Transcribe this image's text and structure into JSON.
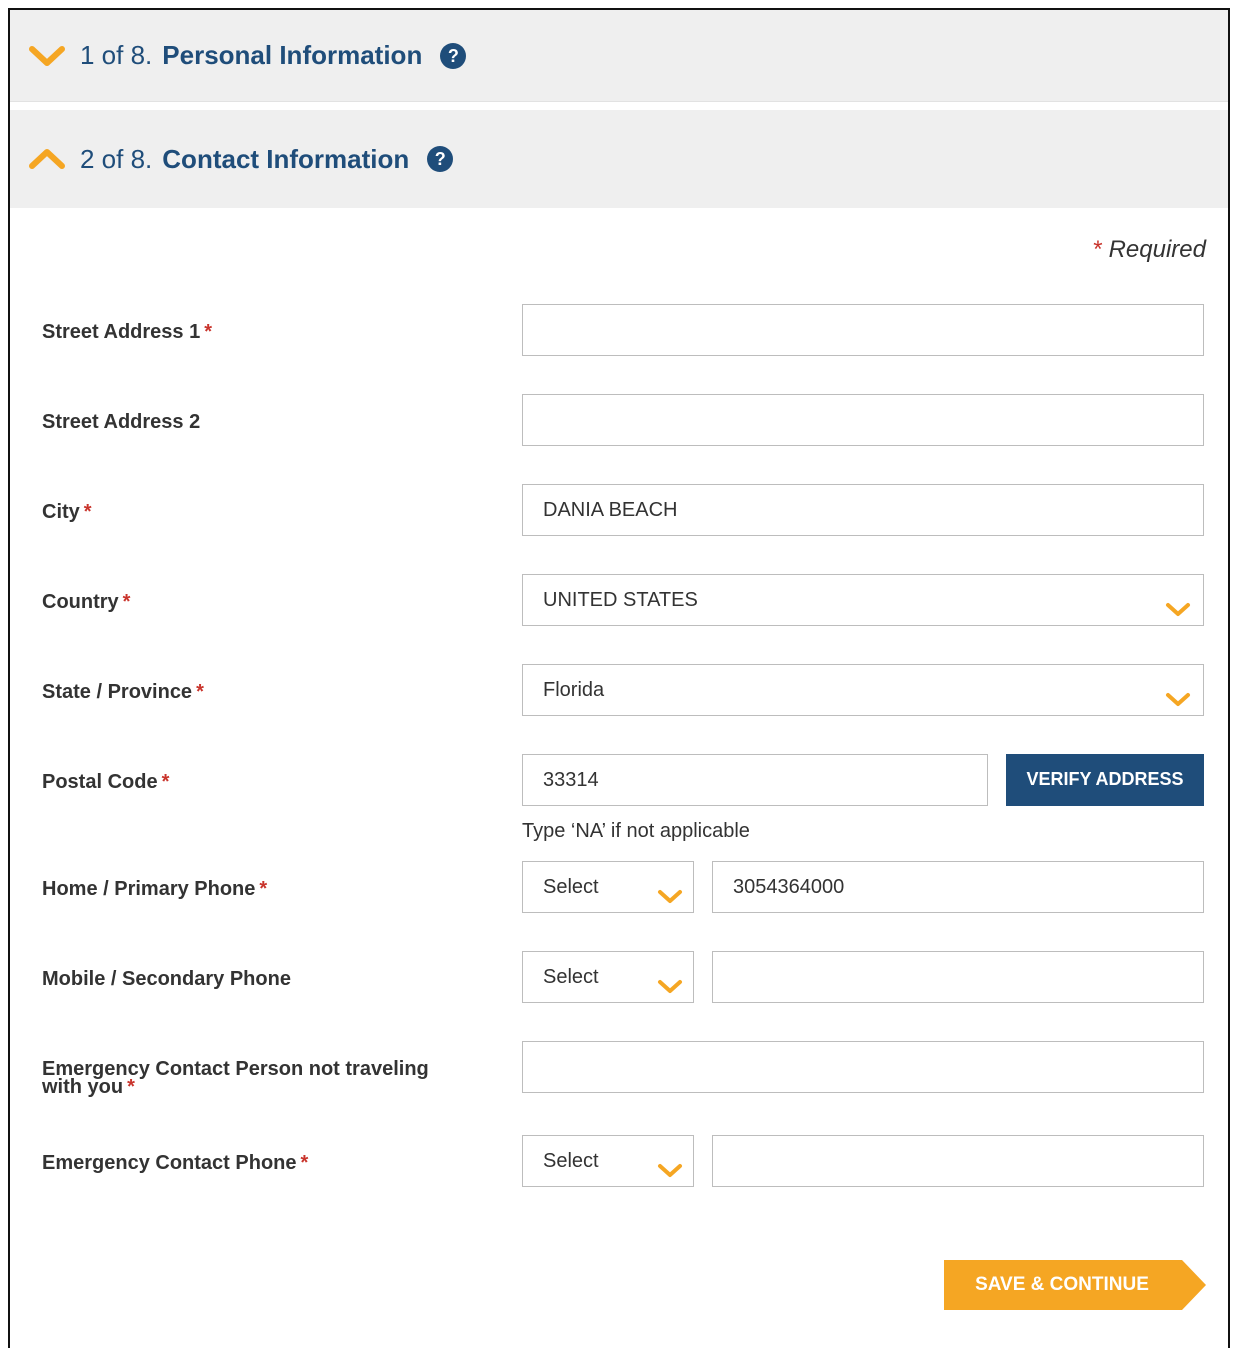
{
  "sections": [
    {
      "number": "1 of 8.",
      "title": "Personal Information",
      "expanded": false
    },
    {
      "number": "2 of 8.",
      "title": "Contact Information",
      "expanded": true
    }
  ],
  "help_glyph": "?",
  "required_note": {
    "star": "*",
    "text": "Required"
  },
  "required_star": "*",
  "fields": {
    "street1": {
      "label": "Street Address 1",
      "value": ""
    },
    "street2": {
      "label": "Street Address 2",
      "value": ""
    },
    "city": {
      "label": "City",
      "value": "DANIA BEACH"
    },
    "country": {
      "label": "Country",
      "value": "UNITED STATES"
    },
    "state": {
      "label": "State / Province",
      "value": "Florida"
    },
    "postal": {
      "label": "Postal Code",
      "value": "33314",
      "hint": "Type ‘NA’ if not applicable"
    },
    "home_phone": {
      "label": "Home / Primary Phone",
      "code": "Select",
      "value": "3054364000"
    },
    "mobile_phone": {
      "label": "Mobile / Secondary Phone",
      "code": "Select",
      "value": ""
    },
    "emergency_person": {
      "label_line1": "Emergency Contact Person not traveling",
      "label_line2": "with you",
      "value": ""
    },
    "emergency_phone": {
      "label": "Emergency Contact Phone",
      "code": "Select",
      "value": ""
    }
  },
  "buttons": {
    "verify": "VERIFY ADDRESS",
    "save": "SAVE & CONTINUE"
  },
  "colors": {
    "accent_orange": "#f5a623",
    "brand_blue": "#1f4d7a",
    "required_red": "#c9342c"
  },
  "icons": {
    "collapsed": "chevron-down-icon",
    "expanded": "chevron-up-icon",
    "help": "question-circle-icon",
    "select": "chevron-down-icon"
  }
}
